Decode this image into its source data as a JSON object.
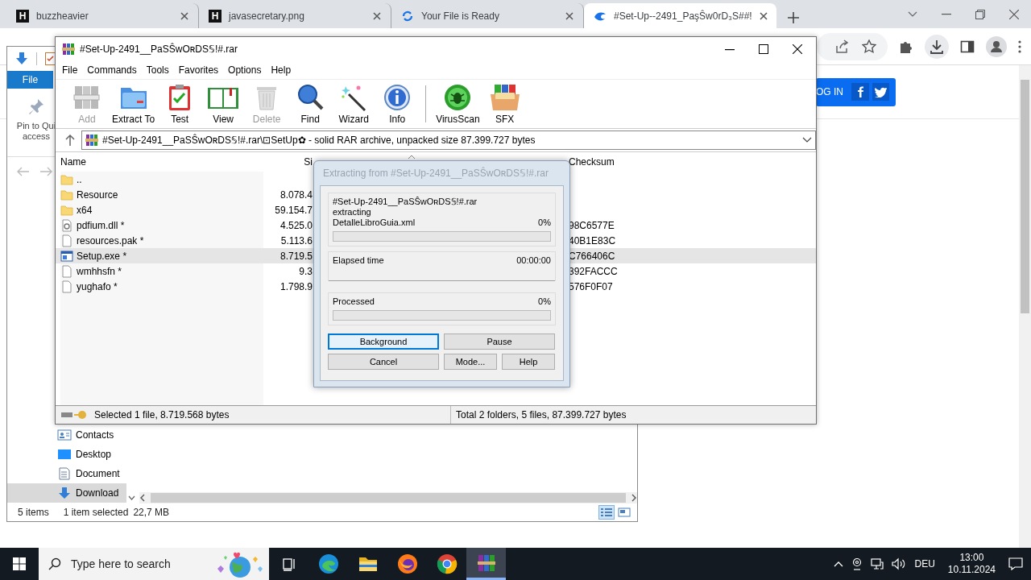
{
  "browser": {
    "tabs": [
      {
        "title": "buzzheavier",
        "kind": "letter",
        "favicon": "H",
        "selected": false
      },
      {
        "title": "javasecretary.png",
        "kind": "letter",
        "favicon": "H",
        "selected": false
      },
      {
        "title": "Your File is Ready",
        "kind": "loading",
        "selected": false
      },
      {
        "title": "#Set-Up--2491_PaşŜw0rD₃S##!",
        "kind": "swirl",
        "selected": true
      }
    ],
    "login_link": "OG IN"
  },
  "explorer": {
    "ribbon_tab": "File",
    "pin_label": "Pin to Qui",
    "pin_label_2": "access",
    "nav_items": [
      {
        "label": "Contacts",
        "kind": "contacts",
        "selected": false
      },
      {
        "label": "Desktop",
        "kind": "desktop",
        "selected": false
      },
      {
        "label": "Document",
        "kind": "documents",
        "selected": false
      },
      {
        "label": "Download",
        "kind": "downloads",
        "selected": true
      }
    ],
    "status_items": "5 items",
    "status_selection": "1 item selected",
    "status_size": "22,7 MB"
  },
  "winrar": {
    "title": "#Set-Up-2491__PaSŜwOʀDS𝕊!#.rar",
    "menu": [
      "File",
      "Commands",
      "Tools",
      "Favorites",
      "Options",
      "Help"
    ],
    "toolbar": [
      [
        {
          "label": "Add",
          "kind": "books",
          "disabled": true
        },
        {
          "label": "Extract To",
          "kind": "folder",
          "disabled": false
        },
        {
          "label": "Test",
          "kind": "clipboard",
          "disabled": false
        },
        {
          "label": "View",
          "kind": "book",
          "disabled": false
        },
        {
          "label": "Delete",
          "kind": "trash",
          "disabled": true
        },
        {
          "label": "Find",
          "kind": "magnifier",
          "disabled": false
        },
        {
          "label": "Wizard",
          "kind": "wand",
          "disabled": false
        },
        {
          "label": "Info",
          "kind": "info",
          "disabled": false
        }
      ],
      [
        {
          "label": "VirusScan",
          "kind": "bug",
          "disabled": false
        },
        {
          "label": "SFX",
          "kind": "box",
          "disabled": false
        }
      ]
    ],
    "address": "#Set-Up-2491__PaSŜwOʀDS𝕊!#.rar\\⊡SetUp✿ - solid RAR archive, unpacked size 87.399.727 bytes",
    "columns": [
      "Name",
      "Si",
      "Checksum"
    ],
    "rows": [
      {
        "name": "..",
        "kind": "folder",
        "size": "",
        "selected": false
      },
      {
        "name": "Resource",
        "kind": "folder",
        "size": "8.078.4",
        "selected": false
      },
      {
        "name": "x64",
        "kind": "folder",
        "size": "59.154.7",
        "selected": false
      },
      {
        "name": "pdfium.dll *",
        "kind": "dll",
        "size": "4.525.0",
        "checksum": "98C6577E",
        "selected": false
      },
      {
        "name": "resources.pak *",
        "kind": "file",
        "size": "5.113.6",
        "checksum": "40B1E83C",
        "selected": false
      },
      {
        "name": "Setup.exe *",
        "kind": "exe",
        "size": "8.719.5",
        "checksum": "C766406C",
        "selected": true
      },
      {
        "name": "wmhhsfn *",
        "kind": "file",
        "size": "9.3",
        "checksum": "392FACCC",
        "selected": false
      },
      {
        "name": "yughafo *",
        "kind": "file",
        "size": "1.798.9",
        "checksum": "576F0F07",
        "selected": false
      }
    ],
    "status_left": "Selected 1 file, 8.719.568 bytes",
    "status_right": "Total 2 folders, 5 files, 87.399.727 bytes"
  },
  "dialog": {
    "title": "Extracting from #Set-Up-2491__PaSŜwOʀDS𝕊!#.rar",
    "archive": "#Set-Up-2491__PaSŜwOʀDS𝕊!#.rar",
    "action": "extracting",
    "file": "DetalleLibroGuia.xml",
    "file_percent": "0%",
    "file_progress": {
      "level": 0
    },
    "elapsed_label": "Elapsed time",
    "elapsed": "00:00:00",
    "processed_label": "Processed",
    "processed_percent": "0%",
    "processed_progress": {
      "level": 0
    },
    "buttons": [
      [
        {
          "label": "Background",
          "focused": true
        },
        {
          "label": "Pause",
          "focused": false
        }
      ],
      [
        {
          "label": "Cancel",
          "focused": false
        },
        {
          "label": "Mode...",
          "focused": false
        },
        {
          "label": "Help",
          "focused": false
        }
      ]
    ]
  },
  "taskbar": {
    "search": {
      "placeholder": "Type here to search"
    },
    "apps": [
      {
        "kind": "task-view",
        "active": false
      },
      {
        "kind": "edge",
        "active": false
      },
      {
        "kind": "folder",
        "active": false
      },
      {
        "kind": "firefox",
        "active": false
      },
      {
        "kind": "chrome",
        "active": false
      },
      {
        "kind": "winrar",
        "active": true
      }
    ],
    "language": "DEU",
    "time": "13:00",
    "date": "10.11.2024"
  }
}
